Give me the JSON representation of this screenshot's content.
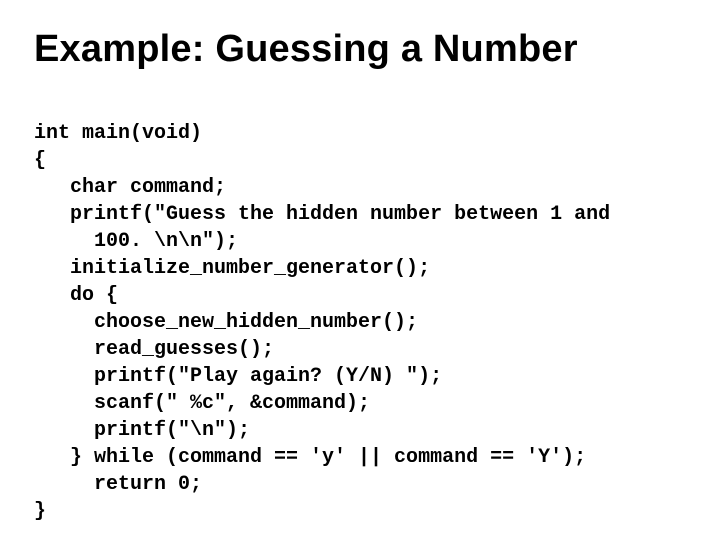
{
  "title": "Example: Guessing a Number",
  "code": {
    "l01": "int main(void)",
    "l02": "{",
    "l03": "   char command;",
    "l04": "   printf(\"Guess the hidden number between 1 and",
    "l05": "     100. \\n\\n\");",
    "l06": "   initialize_number_generator();",
    "l07": "   do {",
    "l08": "     choose_new_hidden_number();",
    "l09": "     read_guesses();",
    "l10": "     printf(\"Play again? (Y/N) \");",
    "l11": "     scanf(\" %c\", &command);",
    "l12": "     printf(\"\\n\");",
    "l13": "   } while (command == 'y' || command == 'Y');",
    "l14": "     return 0;",
    "l15": "}"
  }
}
